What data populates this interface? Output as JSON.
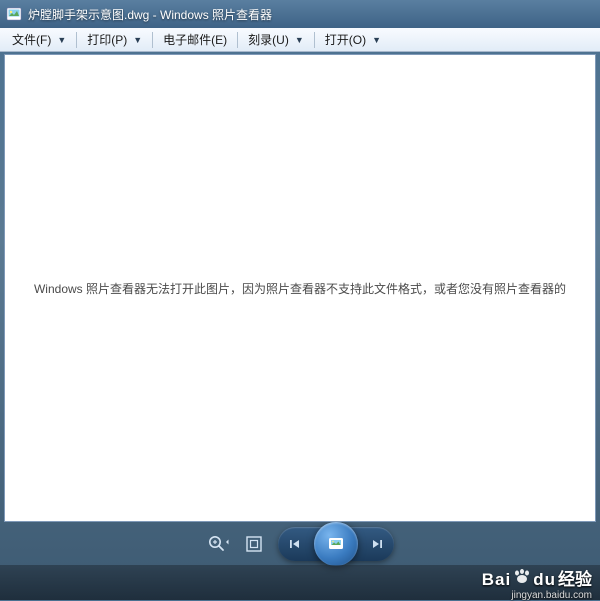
{
  "titlebar": {
    "title": "炉膛脚手架示意图.dwg - Windows 照片查看器"
  },
  "menu": {
    "file": "文件(F)",
    "print": "打印(P)",
    "email": "电子邮件(E)",
    "burn": "刻录(U)",
    "open": "打开(O)"
  },
  "content": {
    "error": "Windows 照片查看器无法打开此图片，因为照片查看器不支持此文件格式，或者您没有照片查看器的"
  },
  "toolbar": {
    "zoom_icon": "zoom",
    "actual_size_icon": "actual-size",
    "prev_icon": "previous",
    "play_icon": "slideshow",
    "next_icon": "next"
  },
  "watermark": {
    "brand": "Bai",
    "brand2": "du",
    "cn": "经验",
    "url": "jingyan.baidu.com"
  }
}
